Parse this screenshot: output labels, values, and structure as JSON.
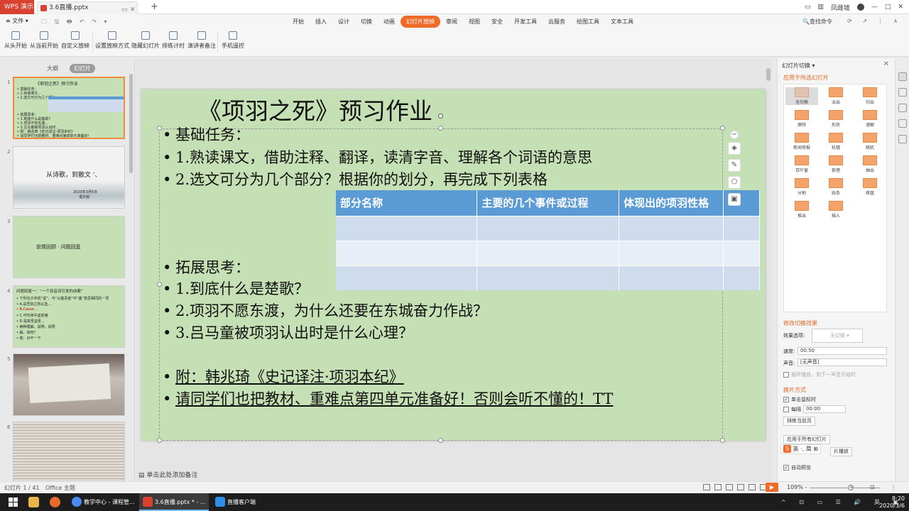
{
  "titlebar": {
    "app_tab": "WPS 演示",
    "file_tab": "3.6直播.pptx",
    "new_tab": "+",
    "user_name": "凤雌墟",
    "window_controls": [
      "—",
      "□",
      "✕"
    ]
  },
  "menubar": {
    "file_label": "≡ 文件 ▾",
    "quick_access": "🗀 🖫 🖶 ↶ ↷ ▾",
    "tabs": [
      "开始",
      "插入",
      "设计",
      "切换",
      "动画",
      "幻灯片放映",
      "审阅",
      "视图",
      "安全",
      "开发工具",
      "云服务",
      "绘图工具",
      "文本工具"
    ],
    "active_tab": "幻灯片放映",
    "search_label": "🔍查找命令",
    "right_icons": "⟳ ↗ ⋮ ∧"
  },
  "toolbar": {
    "items": [
      "从头开始",
      "从当前开始",
      "自定义放映",
      "设置放映方式",
      "隐藏幻灯片",
      "排练计时",
      "演讲者备注",
      "手机遥控"
    ]
  },
  "left_panel": {
    "tabs": [
      "大纲",
      "幻灯片"
    ],
    "active_tab": "幻灯片",
    "thumbs": [
      {
        "num": "1",
        "lines": [
          "《项羽之死》预习作业",
          "• 基础任务：",
          "• 1.熟读课文…",
          "• 2.选文可分为几个部分…",
          "• 拓展思考：",
          "• 1.到底什么是楚歌?",
          "• 2.项羽不愿东渡…",
          "• 3.吕马童被项羽认出时…",
          "• 附：韩兆琦《史记译注·项羽本纪》",
          "• 请同学们也把教材、重难点第四单元准备好!"
        ]
      },
      {
        "num": "2",
        "lines": [
          "从诗歌，到散文 '、",
          "2020年3月6日",
          "语文组"
        ]
      },
      {
        "num": "3",
        "lines": [
          "前情回顾 · 问题回复"
        ]
      },
      {
        "num": "4",
        "lines": [
          "问题回复一：“一个双音词引发的血案”",
          "• 下列句子中的“说”、与“以塞责者”中“塞”意思相同的一项",
          "• A.是吾剑之所从坠…",
          "• B.Cause ...",
          "• C.可怜夜半虚前席",
          "• D.是故圣益圣…",
          "• 两种理解，说明，说明",
          "• 解，如何？",
          "• 答：对不一下"
        ]
      },
      {
        "num": "5",
        "lines": [
          "参考资料图片"
        ]
      },
      {
        "num": "6",
        "lines": [
          "参考资料文字"
        ]
      }
    ]
  },
  "slide": {
    "title": "《项羽之死》预习作业",
    "lines": [
      {
        "text": "基础任务：",
        "underline": false
      },
      {
        "text": "1.熟读课文，借助注释、翻译，读清字音、理解各个词语的意思",
        "underline": false
      },
      {
        "text": "2.选文可分为几个部分？根据你的划分，再完成下列表格",
        "underline": false
      },
      {
        "text": "拓展思考：",
        "underline": false
      },
      {
        "text": "1.到底什么是楚歌？",
        "underline": false
      },
      {
        "text": "2.项羽不愿东渡，为什么还要在东城奋力作战？",
        "underline": false
      },
      {
        "text": "3.吕马童被项羽认出时是什么心理？",
        "underline": false
      },
      {
        "text": "附：韩兆琦《史记译注·项羽本纪》",
        "underline": true
      },
      {
        "text": "请同学们也把教材、重难点第四单元准备好！否则会听不懂的！TT",
        "underline": true
      }
    ],
    "table": {
      "headers": [
        "部分名称",
        "主要的几个事件或过程",
        "体现出的项羽性格",
        ""
      ],
      "rows": [
        [
          "",
          "",
          "",
          ""
        ],
        [
          "",
          "",
          "",
          ""
        ],
        [
          "",
          "",
          "",
          ""
        ]
      ]
    },
    "notes_placeholder": "单击此处添加备注"
  },
  "right_panel": {
    "title": "幻灯片切换 ▾",
    "apply_selected": "应用于所选幻灯片",
    "transitions": [
      "无切换",
      "淡出",
      "切出",
      "擦除",
      "形状",
      "溶解",
      "新闻快报",
      "轮辐",
      "随机",
      "百叶窗",
      "梳理",
      "抽出",
      "分割",
      "线条",
      "棋盘",
      "推出",
      "插入"
    ],
    "active_transition": "无切换",
    "modify_label": "修改切换效果",
    "effect_label": "效果选项:",
    "effect_value": "无切换",
    "speed_label": "速度:",
    "speed_value": "00.50",
    "sound_label": "声音:",
    "sound_value": "[无声音]",
    "loop_label": "循环播放，到下一声音开始时",
    "advance_label": "换片方式",
    "on_click_label": "单击鼠标时",
    "every_label": "每隔",
    "every_value": "00:00",
    "rehearse_button": "排练当前页",
    "apply_all_button": "应用于所有幻灯片",
    "play_label": "片播放",
    "auto_preview_label": "自动预览",
    "ime_text": "英 ·, 简 ⊞"
  },
  "statusbar": {
    "slide_info": "幻灯片 1 / 41",
    "theme": "Office 主题",
    "zoom": "109% -",
    "zoom_percent": 109,
    "icons": "+ ⊡ ⋮"
  },
  "taskbar": {
    "tasks": [
      "教学中心 - 课程管...",
      "3.6直播.pptx * - ...",
      "直播客户端"
    ],
    "active_task": "3.6直播.pptx * - ...",
    "time": "8:20",
    "date": "2020/3/6",
    "tray": "^ ⊡ ▭ ☰ 🔊 英 ▣"
  },
  "colors": {
    "accent": "#f06a28",
    "slide_bg": "#c5e0b4",
    "table_header": "#5b9bd5",
    "table_row_dark": "#cfdcee",
    "table_row_light": "#e8eef7",
    "wps_red": "#d8402f"
  }
}
